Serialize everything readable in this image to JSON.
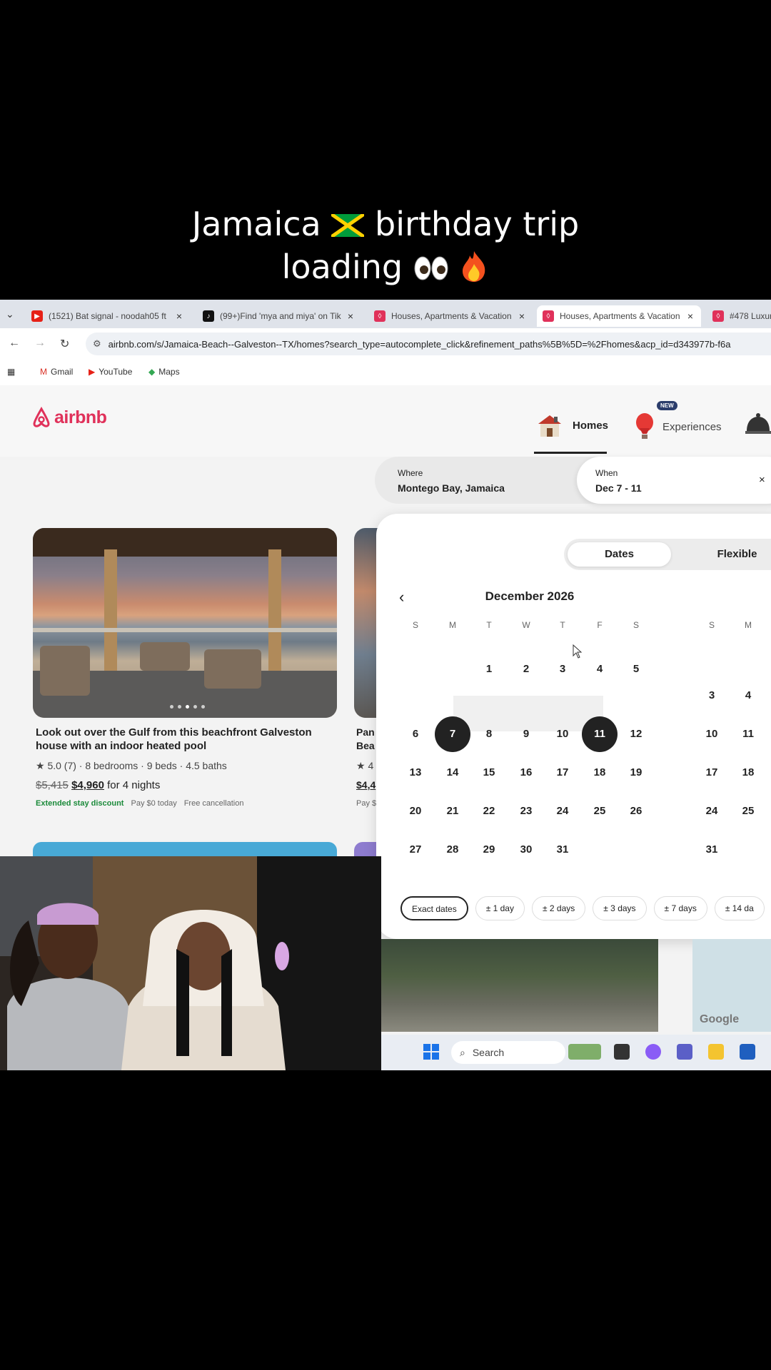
{
  "caption": {
    "line1_before": "Jamaica",
    "line1_after": "birthday trip",
    "line2": "loading"
  },
  "colors": {
    "airbnb": "#e0315a",
    "selected": "#222222",
    "green": "#1b8a3a"
  },
  "browser": {
    "tabs": [
      {
        "title": "(1521) Bat signal - noodah05 ft",
        "icon": "youtube-icon",
        "active": false
      },
      {
        "title": "(99+)Find 'mya and miya' on Tik",
        "icon": "tiktok-icon",
        "active": false
      },
      {
        "title": "Houses, Apartments & Vacation",
        "icon": "airbnb-icon",
        "active": false
      },
      {
        "title": "Houses, Apartments & Vacation",
        "icon": "airbnb-icon",
        "active": true
      },
      {
        "title": "#478 Luxur",
        "icon": "airbnb-icon",
        "active": false
      }
    ],
    "url": "airbnb.com/s/Jamaica-Beach--Galveston--TX/homes?search_type=autocomplete_click&refinement_paths%5B%5D=%2Fhomes&acp_id=d343977b-f6a",
    "bookmarks": [
      "Gmail",
      "YouTube",
      "Maps"
    ]
  },
  "airbnb": {
    "logo": "airbnb",
    "nav": {
      "homes": "Homes",
      "experiences": "Experiences",
      "new_badge": "NEW"
    },
    "search": {
      "where_label": "Where",
      "where_value": "Montego Bay, Jamaica",
      "when_label": "When",
      "when_value": "Dec 7 - 11",
      "clear": "×"
    },
    "listing": {
      "title": "Look out over the Gulf from this beachfront Galveston house with an indoor heated pool",
      "meta": "★ 5.0 (7) · 8 bedrooms · 9 beds · 4.5 baths",
      "old_price": "$5,415",
      "new_price": "$4,960",
      "price_suffix": "for 4 nights",
      "tags": [
        "Extended stay discount",
        "Pay $0 today",
        "Free cancellation"
      ],
      "partial": [
        "Pan",
        "Bea",
        "★ 4",
        "$4,4",
        "Pay $"
      ]
    },
    "calendar": {
      "tabs": {
        "dates": "Dates",
        "flexible": "Flexible"
      },
      "month": "December 2026",
      "weekdays": [
        "S",
        "M",
        "T",
        "W",
        "T",
        "F",
        "S"
      ],
      "next_weekdays": [
        "S",
        "M"
      ],
      "weeks": [
        [
          "",
          "",
          "1",
          "2",
          "3",
          "4",
          "5"
        ],
        [
          "6",
          "7",
          "8",
          "9",
          "10",
          "11",
          "12"
        ],
        [
          "13",
          "14",
          "15",
          "16",
          "17",
          "18",
          "19"
        ],
        [
          "20",
          "21",
          "22",
          "23",
          "24",
          "25",
          "26"
        ],
        [
          "27",
          "28",
          "29",
          "30",
          "31",
          "",
          ""
        ]
      ],
      "next_month_days": [
        [
          "",
          ""
        ],
        [
          "3",
          "4"
        ],
        [
          "10",
          "11"
        ],
        [
          "17",
          "18"
        ],
        [
          "24",
          "25"
        ],
        [
          "31",
          ""
        ]
      ],
      "selected": [
        "7",
        "11"
      ],
      "chips": [
        "Exact dates",
        "± 1 day",
        "± 2 days",
        "± 3 days",
        "± 7 days",
        "± 14 da"
      ]
    }
  },
  "taskbar": {
    "search": "Search"
  },
  "map": {
    "brand": "Google"
  }
}
